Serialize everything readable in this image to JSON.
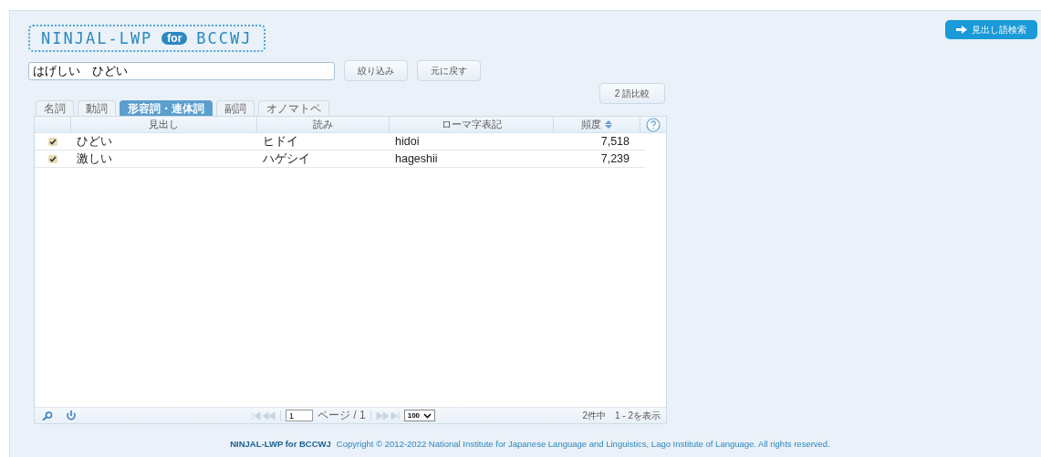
{
  "header": {
    "logo": {
      "name": "NINJAL-LWP",
      "badge": "for",
      "suffix": "BCCWJ"
    },
    "search_button": "見出し語検索"
  },
  "search": {
    "value": "はげしい　ひどい"
  },
  "buttons": [
    "絞り込み",
    "元に戻す"
  ],
  "compare_button": "2 語比較",
  "tabs": [
    {
      "label": "名詞",
      "selected": false
    },
    {
      "label": "動詞",
      "selected": false
    },
    {
      "label": "形容詞・連体詞",
      "selected": true
    },
    {
      "label": "副詞",
      "selected": false
    },
    {
      "label": "オノマトペ",
      "selected": false
    }
  ],
  "table": {
    "columns": [
      {
        "label": "見出し",
        "sorted": false
      },
      {
        "label": "読み",
        "sorted": false
      },
      {
        "label": "ローマ字表記",
        "sorted": false
      },
      {
        "label": "頻度",
        "sorted": true
      }
    ],
    "rows": [
      {
        "checked": true,
        "cells": [
          "ひどい",
          "ヒドイ",
          "hidoi",
          "7,518"
        ]
      },
      {
        "checked": true,
        "cells": [
          "激しい",
          "ハゲシイ",
          "hageshii",
          "7,239"
        ]
      }
    ]
  },
  "pager": {
    "page": "1",
    "page_label": "ページ / 1",
    "page_size": "100",
    "summary": "2件中　1 - 2を表示"
  },
  "footer": {
    "brand": "NINJAL-LWP for BCCWJ",
    "copyright": "Copyright © 2012-2022 National Institute for Japanese Language and Linguistics, Lago Institute of Language. All rights reserved."
  }
}
